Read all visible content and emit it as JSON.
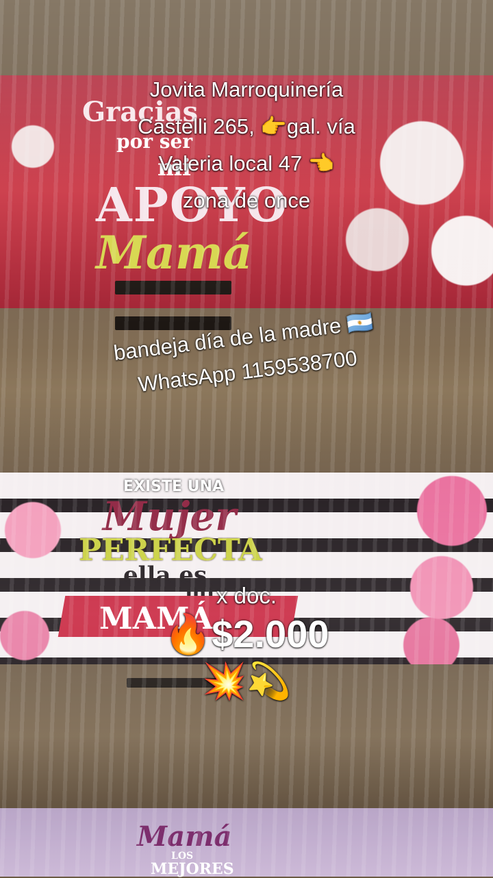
{
  "trays": {
    "top": {
      "line1": "Gracias",
      "line2": "por ser",
      "line3": "mi",
      "line4": "APOYO",
      "line5": "Mamá"
    },
    "middle": {
      "line1": "EXISTE UNA",
      "line2": "Mujer",
      "line3": "PERFECTA",
      "line4": "ella es",
      "line5": "mi",
      "line6": "MAMÁ"
    },
    "bottom": {
      "line1": "Mamá",
      "line2": "LOS",
      "line3": "MEJORES"
    }
  },
  "overlay": {
    "address": {
      "line1": "Jovita Marroquinería",
      "line2": "Castelli 265, 👉gal. vía",
      "line3": "Valeria local 47 👈",
      "line4": "zona de once"
    },
    "product": {
      "line1": "bandeja día de la madre 🇦🇷",
      "line2": "WhatsApp 1159538700"
    },
    "price": {
      "unit": "x doc.",
      "amount": "🔥$2.000",
      "emojis": "💥💫"
    }
  }
}
